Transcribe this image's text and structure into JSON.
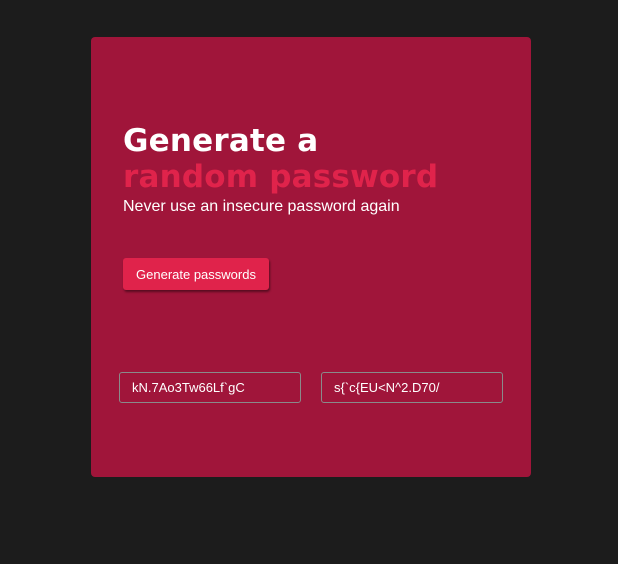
{
  "card": {
    "headline_line1": "Generate a",
    "headline_line2": "random password",
    "subtitle": "Never use an insecure password again",
    "generate_button_label": "Generate passwords"
  },
  "passwords": [
    "kN.7Ao3Tw66Lf`gC",
    "s{`c{EU<N^2.D70/"
  ],
  "colors": {
    "page_background": "#1c1c1c",
    "card_background": "#a0153a",
    "accent": "#e0234b",
    "text": "#ffffff"
  }
}
